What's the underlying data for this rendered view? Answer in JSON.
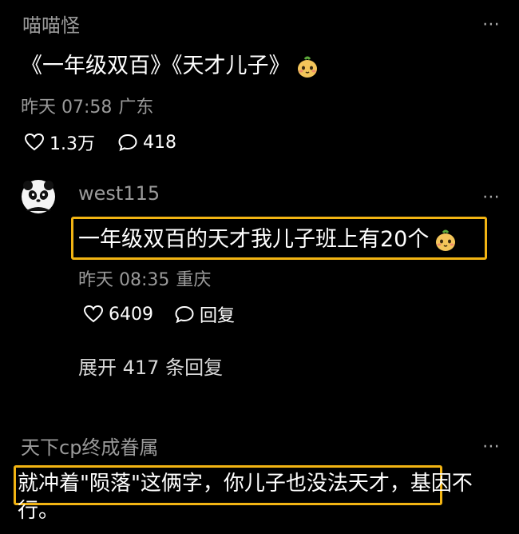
{
  "comment1": {
    "username": "喵喵怪",
    "text": "《一年级双百》《天才儿子》",
    "emoji": "pear-face-emoji",
    "time": "昨天 07:58",
    "location": "广东",
    "likes": "1.3万",
    "replies": "418"
  },
  "reply1": {
    "username": "west115",
    "text": "一年级双百的天才我儿子班上有20个",
    "emoji": "pear-face-emoji",
    "time": "昨天 08:35",
    "location": "重庆",
    "likes": "6409",
    "reply_label": "回复"
  },
  "expand_label": "展开 417 条回复",
  "comment2": {
    "username": "天下cp终成眷属",
    "text_highlighted": "就冲着\"陨落\"这俩字，你儿子也没法天才，",
    "text_rest": "基因不行。"
  },
  "colors": {
    "background": "#000000",
    "highlight": "#f2b413",
    "muted_text": "#9a9a9a"
  },
  "icons": [
    "heart-icon",
    "comment-icon",
    "more-icon",
    "panda-avatar",
    "pear-face-emoji"
  ]
}
